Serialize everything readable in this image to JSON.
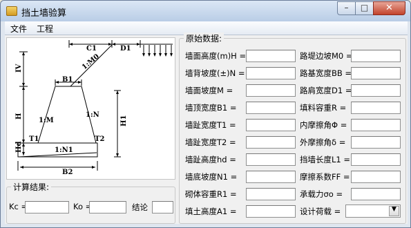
{
  "window": {
    "title": "挡土墙验算"
  },
  "titlebar_buttons": {
    "minimize": "–",
    "maximize": "□",
    "close": "✕"
  },
  "menu": [
    "文件",
    "工程"
  ],
  "diagram": {
    "labels": {
      "c1": "C1",
      "d1": "D1",
      "slope_top": "1:M0",
      "b1": "B1",
      "m": "1:M",
      "n": "1:N",
      "iv": "IV",
      "h": "H",
      "hd": "Hd",
      "t1": "T1",
      "t2": "T2",
      "n1": "1:N1",
      "b2": "B2",
      "h1": "H1"
    }
  },
  "results": {
    "legend": "计算结果:",
    "kc_label": "Kc =",
    "kc_value": "",
    "ko_label": "Ko =",
    "ko_value": "",
    "conclusion_label": "结论",
    "conclusion_value": ""
  },
  "data_group": {
    "legend": "原始数据:",
    "left_fields": [
      {
        "label": "墙面高度(m)H =",
        "value": ""
      },
      {
        "label": "墙背坡度(±)N =",
        "value": ""
      },
      {
        "label": "墙面坡度M =",
        "value": ""
      },
      {
        "label": "墙顶宽度B1 =",
        "value": ""
      },
      {
        "label": "墙趾宽度T1 =",
        "value": ""
      },
      {
        "label": "墙趾宽度T2 =",
        "value": ""
      },
      {
        "label": "墙趾高度hd =",
        "value": ""
      },
      {
        "label": "墙底坡度N1 =",
        "value": ""
      },
      {
        "label": "砌体容重R1 =",
        "value": ""
      },
      {
        "label": "填土高度A1 =",
        "value": ""
      }
    ],
    "right_fields": [
      {
        "label": "路堤边坡M0 =",
        "value": ""
      },
      {
        "label": "路基宽度BB =",
        "value": ""
      },
      {
        "label": "路肩宽度D1 =",
        "value": ""
      },
      {
        "label": "填料容重R =",
        "value": ""
      },
      {
        "label": "内摩擦角Φ =",
        "value": ""
      },
      {
        "label": "外摩擦角δ =",
        "value": ""
      },
      {
        "label": "挡墙长度L1 =",
        "value": ""
      },
      {
        "label": "摩擦系数FF =",
        "value": ""
      },
      {
        "label": "承载力σo =",
        "value": ""
      }
    ],
    "design_load": {
      "label": "设计荷载 =",
      "value": "",
      "dropdown_icon": "chevron-down-icon"
    }
  }
}
